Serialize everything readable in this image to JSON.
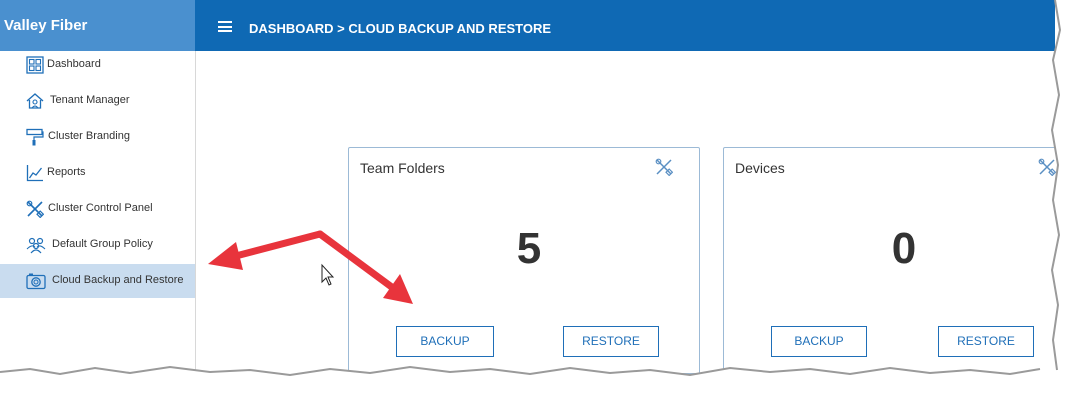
{
  "sidebar": {
    "brand": "Valley Fiber",
    "items": [
      {
        "label": "Dashboard",
        "icon": "dashboard-grid-icon"
      },
      {
        "label": "Tenant Manager",
        "icon": "tenant-house-icon"
      },
      {
        "label": "Cluster Branding",
        "icon": "paint-roller-icon"
      },
      {
        "label": "Reports",
        "icon": "line-chart-icon"
      },
      {
        "label": "Cluster Control Panel",
        "icon": "tools-icon"
      },
      {
        "label": "Default Group Policy",
        "icon": "users-group-icon"
      },
      {
        "label": "Cloud Backup and Restore",
        "icon": "camera-icon",
        "active": true
      }
    ]
  },
  "header": {
    "breadcrumb": "DASHBOARD > CLOUD BACKUP AND RESTORE"
  },
  "cards": [
    {
      "title": "Team Folders",
      "count": "5",
      "backup_label": "BACKUP",
      "restore_label": "RESTORE"
    },
    {
      "title": "Devices",
      "count": "0",
      "backup_label": "BACKUP",
      "restore_label": "RESTORE"
    }
  ],
  "colors": {
    "topbar": "#0f69b4",
    "brand": "#4a90cf",
    "active_item": "#c9dcef",
    "button_border": "#1f6fb8",
    "annotation_arrow": "#e8343c"
  }
}
